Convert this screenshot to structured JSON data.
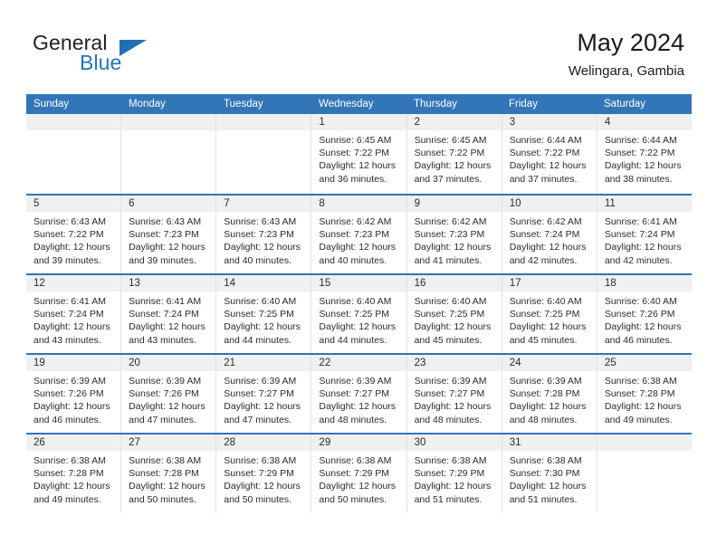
{
  "brand": {
    "word_one": "General",
    "word_two": "Blue",
    "flag_icon": "triangle-flag-icon"
  },
  "header": {
    "title": "May 2024",
    "subtitle": "Welingara, Gambia"
  },
  "colors": {
    "header_blue": "#3276b8",
    "row_divider_blue": "#2f74b5",
    "daynum_band": "#f0f0f0",
    "brand_blue": "#2176bd"
  },
  "weekday_headers": [
    "Sunday",
    "Monday",
    "Tuesday",
    "Wednesday",
    "Thursday",
    "Friday",
    "Saturday"
  ],
  "weeks": [
    [
      {
        "day": "",
        "sunrise": "",
        "sunset": "",
        "daylight_1": "",
        "daylight_2": ""
      },
      {
        "day": "",
        "sunrise": "",
        "sunset": "",
        "daylight_1": "",
        "daylight_2": ""
      },
      {
        "day": "",
        "sunrise": "",
        "sunset": "",
        "daylight_1": "",
        "daylight_2": ""
      },
      {
        "day": "1",
        "sunrise": "Sunrise: 6:45 AM",
        "sunset": "Sunset: 7:22 PM",
        "daylight_1": "Daylight: 12 hours",
        "daylight_2": "and 36 minutes."
      },
      {
        "day": "2",
        "sunrise": "Sunrise: 6:45 AM",
        "sunset": "Sunset: 7:22 PM",
        "daylight_1": "Daylight: 12 hours",
        "daylight_2": "and 37 minutes."
      },
      {
        "day": "3",
        "sunrise": "Sunrise: 6:44 AM",
        "sunset": "Sunset: 7:22 PM",
        "daylight_1": "Daylight: 12 hours",
        "daylight_2": "and 37 minutes."
      },
      {
        "day": "4",
        "sunrise": "Sunrise: 6:44 AM",
        "sunset": "Sunset: 7:22 PM",
        "daylight_1": "Daylight: 12 hours",
        "daylight_2": "and 38 minutes."
      }
    ],
    [
      {
        "day": "5",
        "sunrise": "Sunrise: 6:43 AM",
        "sunset": "Sunset: 7:22 PM",
        "daylight_1": "Daylight: 12 hours",
        "daylight_2": "and 39 minutes."
      },
      {
        "day": "6",
        "sunrise": "Sunrise: 6:43 AM",
        "sunset": "Sunset: 7:23 PM",
        "daylight_1": "Daylight: 12 hours",
        "daylight_2": "and 39 minutes."
      },
      {
        "day": "7",
        "sunrise": "Sunrise: 6:43 AM",
        "sunset": "Sunset: 7:23 PM",
        "daylight_1": "Daylight: 12 hours",
        "daylight_2": "and 40 minutes."
      },
      {
        "day": "8",
        "sunrise": "Sunrise: 6:42 AM",
        "sunset": "Sunset: 7:23 PM",
        "daylight_1": "Daylight: 12 hours",
        "daylight_2": "and 40 minutes."
      },
      {
        "day": "9",
        "sunrise": "Sunrise: 6:42 AM",
        "sunset": "Sunset: 7:23 PM",
        "daylight_1": "Daylight: 12 hours",
        "daylight_2": "and 41 minutes."
      },
      {
        "day": "10",
        "sunrise": "Sunrise: 6:42 AM",
        "sunset": "Sunset: 7:24 PM",
        "daylight_1": "Daylight: 12 hours",
        "daylight_2": "and 42 minutes."
      },
      {
        "day": "11",
        "sunrise": "Sunrise: 6:41 AM",
        "sunset": "Sunset: 7:24 PM",
        "daylight_1": "Daylight: 12 hours",
        "daylight_2": "and 42 minutes."
      }
    ],
    [
      {
        "day": "12",
        "sunrise": "Sunrise: 6:41 AM",
        "sunset": "Sunset: 7:24 PM",
        "daylight_1": "Daylight: 12 hours",
        "daylight_2": "and 43 minutes."
      },
      {
        "day": "13",
        "sunrise": "Sunrise: 6:41 AM",
        "sunset": "Sunset: 7:24 PM",
        "daylight_1": "Daylight: 12 hours",
        "daylight_2": "and 43 minutes."
      },
      {
        "day": "14",
        "sunrise": "Sunrise: 6:40 AM",
        "sunset": "Sunset: 7:25 PM",
        "daylight_1": "Daylight: 12 hours",
        "daylight_2": "and 44 minutes."
      },
      {
        "day": "15",
        "sunrise": "Sunrise: 6:40 AM",
        "sunset": "Sunset: 7:25 PM",
        "daylight_1": "Daylight: 12 hours",
        "daylight_2": "and 44 minutes."
      },
      {
        "day": "16",
        "sunrise": "Sunrise: 6:40 AM",
        "sunset": "Sunset: 7:25 PM",
        "daylight_1": "Daylight: 12 hours",
        "daylight_2": "and 45 minutes."
      },
      {
        "day": "17",
        "sunrise": "Sunrise: 6:40 AM",
        "sunset": "Sunset: 7:25 PM",
        "daylight_1": "Daylight: 12 hours",
        "daylight_2": "and 45 minutes."
      },
      {
        "day": "18",
        "sunrise": "Sunrise: 6:40 AM",
        "sunset": "Sunset: 7:26 PM",
        "daylight_1": "Daylight: 12 hours",
        "daylight_2": "and 46 minutes."
      }
    ],
    [
      {
        "day": "19",
        "sunrise": "Sunrise: 6:39 AM",
        "sunset": "Sunset: 7:26 PM",
        "daylight_1": "Daylight: 12 hours",
        "daylight_2": "and 46 minutes."
      },
      {
        "day": "20",
        "sunrise": "Sunrise: 6:39 AM",
        "sunset": "Sunset: 7:26 PM",
        "daylight_1": "Daylight: 12 hours",
        "daylight_2": "and 47 minutes."
      },
      {
        "day": "21",
        "sunrise": "Sunrise: 6:39 AM",
        "sunset": "Sunset: 7:27 PM",
        "daylight_1": "Daylight: 12 hours",
        "daylight_2": "and 47 minutes."
      },
      {
        "day": "22",
        "sunrise": "Sunrise: 6:39 AM",
        "sunset": "Sunset: 7:27 PM",
        "daylight_1": "Daylight: 12 hours",
        "daylight_2": "and 48 minutes."
      },
      {
        "day": "23",
        "sunrise": "Sunrise: 6:39 AM",
        "sunset": "Sunset: 7:27 PM",
        "daylight_1": "Daylight: 12 hours",
        "daylight_2": "and 48 minutes."
      },
      {
        "day": "24",
        "sunrise": "Sunrise: 6:39 AM",
        "sunset": "Sunset: 7:28 PM",
        "daylight_1": "Daylight: 12 hours",
        "daylight_2": "and 48 minutes."
      },
      {
        "day": "25",
        "sunrise": "Sunrise: 6:38 AM",
        "sunset": "Sunset: 7:28 PM",
        "daylight_1": "Daylight: 12 hours",
        "daylight_2": "and 49 minutes."
      }
    ],
    [
      {
        "day": "26",
        "sunrise": "Sunrise: 6:38 AM",
        "sunset": "Sunset: 7:28 PM",
        "daylight_1": "Daylight: 12 hours",
        "daylight_2": "and 49 minutes."
      },
      {
        "day": "27",
        "sunrise": "Sunrise: 6:38 AM",
        "sunset": "Sunset: 7:28 PM",
        "daylight_1": "Daylight: 12 hours",
        "daylight_2": "and 50 minutes."
      },
      {
        "day": "28",
        "sunrise": "Sunrise: 6:38 AM",
        "sunset": "Sunset: 7:29 PM",
        "daylight_1": "Daylight: 12 hours",
        "daylight_2": "and 50 minutes."
      },
      {
        "day": "29",
        "sunrise": "Sunrise: 6:38 AM",
        "sunset": "Sunset: 7:29 PM",
        "daylight_1": "Daylight: 12 hours",
        "daylight_2": "and 50 minutes."
      },
      {
        "day": "30",
        "sunrise": "Sunrise: 6:38 AM",
        "sunset": "Sunset: 7:29 PM",
        "daylight_1": "Daylight: 12 hours",
        "daylight_2": "and 51 minutes."
      },
      {
        "day": "31",
        "sunrise": "Sunrise: 6:38 AM",
        "sunset": "Sunset: 7:30 PM",
        "daylight_1": "Daylight: 12 hours",
        "daylight_2": "and 51 minutes."
      },
      {
        "day": "",
        "sunrise": "",
        "sunset": "",
        "daylight_1": "",
        "daylight_2": ""
      }
    ]
  ]
}
